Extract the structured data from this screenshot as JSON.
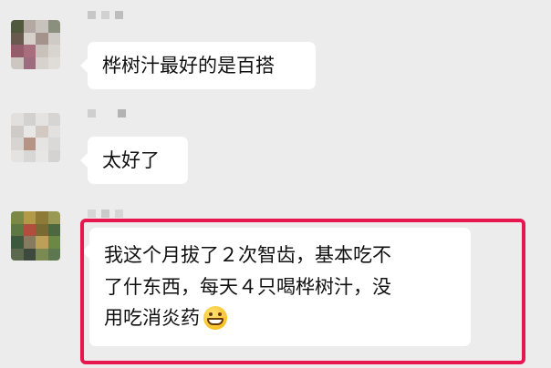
{
  "chat": {
    "messages": [
      {
        "text": "桦树汁最好的是百搭"
      },
      {
        "text": "太好了"
      },
      {
        "line1": "我这个月拔了２次智齿，基本吃不",
        "line2": "了什东西，每天４只喝桦树汁，没",
        "line3": "用吃消炎药",
        "emoji": "grin-emoji"
      }
    ]
  },
  "colors": {
    "highlight": "#e8164f",
    "background": "#ececec",
    "bubble": "#ffffff"
  }
}
